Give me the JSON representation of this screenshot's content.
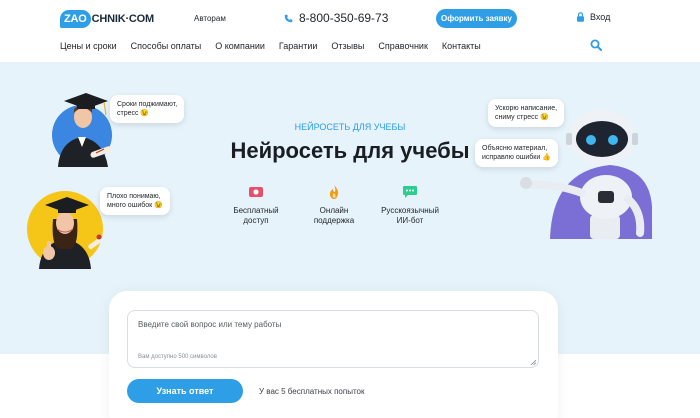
{
  "header": {
    "logo_badge": "ZAO",
    "logo_rest": "CHNIK·COM",
    "authors": "Авторам",
    "phone": "8-800-350-69-73",
    "cta": "Оформить заявку",
    "login": "Вход",
    "nav": [
      "Цены и сроки",
      "Способы оплаты",
      "О компании",
      "Гарантии",
      "Отзывы",
      "Справочник",
      "Контакты"
    ]
  },
  "hero": {
    "subtitle": "НЕЙРОСЕТЬ ДЛЯ УЧЕБЫ",
    "title": "Нейросеть для учебы",
    "features": [
      {
        "line1": "Бесплатный",
        "line2": "доступ"
      },
      {
        "line1": "Онлайн",
        "line2": "поддержка"
      },
      {
        "line1": "Русскоязычный",
        "line2": "ИИ-бот"
      }
    ],
    "bubbles": {
      "left_top": [
        "Сроки поджимают,",
        "стресс 😉"
      ],
      "left_bottom": [
        "Плохо понимаю,",
        "много ошибок 😉"
      ],
      "right_top": [
        "Ускорю написание,",
        "сниму стресс 😉"
      ],
      "right_bottom": [
        "Объясню материал,",
        "исправлю ошибки 👍"
      ]
    }
  },
  "form": {
    "placeholder": "Введите свой вопрос или тему работы",
    "counter": "Вам доступно 500 символов",
    "button": "Узнать ответ",
    "attempts": "У вас 5 бесплатных попыток"
  },
  "colors": {
    "accent": "#2e9ee6",
    "hero_bg": "#e6f3fa"
  }
}
